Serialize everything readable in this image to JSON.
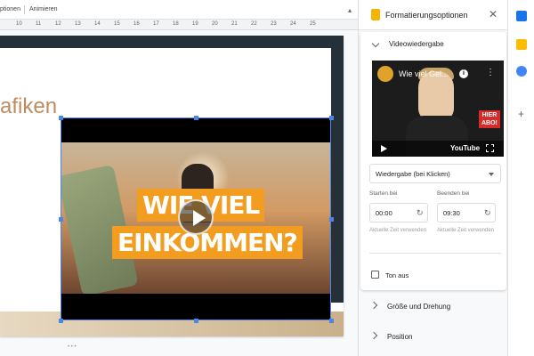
{
  "toolbar": {
    "options_tab": "ptionen",
    "animate_button": "Animieren",
    "collapse_icon": "chevron-up-icon"
  },
  "ruler": {
    "ticks": [
      "10",
      "11",
      "12",
      "13",
      "14",
      "15",
      "16",
      "17",
      "18",
      "19",
      "20",
      "21",
      "22",
      "23",
      "24",
      "25"
    ]
  },
  "slide": {
    "title_fragment": "afiken",
    "video_overlay": {
      "line1": "WIE VIEL",
      "line2": "EINKOMMEN?"
    }
  },
  "panel": {
    "title": "Formatierungsoptionen",
    "close_icon": "close-icon",
    "section_video": "Videowiedergabe",
    "thumbnail": {
      "title": "Wie viel Gel...",
      "badge_line1": "HIER",
      "badge_line2": "ABO!",
      "platform_logo": "YouTube"
    },
    "playback_select": "Wiedergabe (bei Klicken)",
    "start_label": "Starten bei",
    "end_label": "Beenden bei",
    "start_value": "00:00",
    "end_value": "09:30",
    "use_current_start": "Aktuelle Zeit verwenden",
    "use_current_end": "Aktuelle Zeit verwenden",
    "mute_label": "Ton aus",
    "section_size": "Größe und Drehung",
    "section_position": "Position"
  },
  "colors": {
    "accent_blue": "#4a86e8",
    "brand_orange": "#f29d1f",
    "slides_yellow": "#f4b400"
  }
}
